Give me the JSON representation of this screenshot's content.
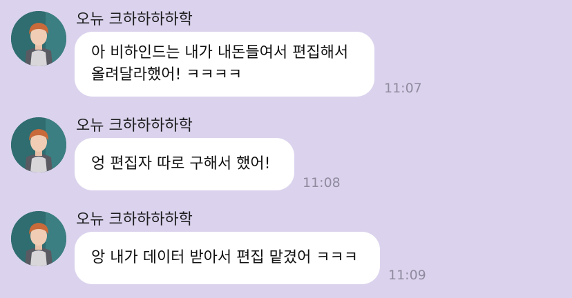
{
  "colors": {
    "background": "#dbd3ed",
    "bubble": "#ffffff",
    "time": "#8f8a9e",
    "avatar_bg": "#2f6d70"
  },
  "messages": [
    {
      "sender": "오뉴 크하하하하학",
      "lines": [
        "아 비하인드는 내가 내돈들여서 편집해서",
        "올려달라했어! ㅋㅋㅋㅋ"
      ],
      "time": "11:07",
      "avatar_icon": "profile-photo-icon"
    },
    {
      "sender": "오뉴 크하하하하학",
      "lines": [
        "엉 편집자 따로 구해서 했어!"
      ],
      "time": "11:08",
      "avatar_icon": "profile-photo-icon"
    },
    {
      "sender": "오뉴 크하하하하학",
      "lines": [
        "앙 내가 데이터 받아서 편집 맡겼어 ㅋㅋㅋ"
      ],
      "time": "11:09",
      "avatar_icon": "profile-photo-icon"
    }
  ]
}
